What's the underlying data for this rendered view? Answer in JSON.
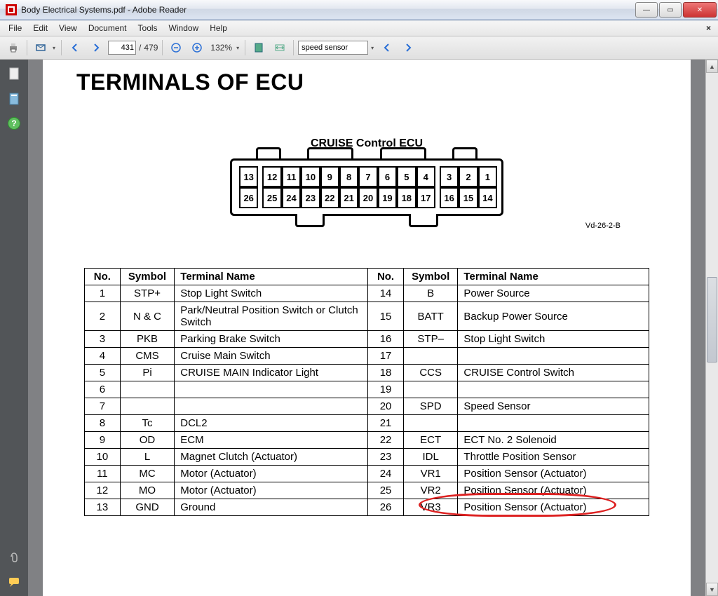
{
  "window": {
    "title": "Body Electrical Systems.pdf - Adobe Reader"
  },
  "menu": {
    "file": "File",
    "edit": "Edit",
    "view": "View",
    "document": "Document",
    "tools": "Tools",
    "window": "Window",
    "help": "Help"
  },
  "toolbar": {
    "page_current": "431",
    "page_sep": "/",
    "page_total": "479",
    "zoom": "132%",
    "search_value": "speed sensor"
  },
  "document": {
    "heading": "TERMINALS OF ECU",
    "ecu_title": "CRUISE Control ECU",
    "fig_ref": "Vd-26-2-B",
    "pins_top": [
      "13",
      "12",
      "11",
      "10",
      "9",
      "8",
      "7",
      "6",
      "5",
      "4",
      "3",
      "2",
      "1"
    ],
    "pins_bot": [
      "26",
      "25",
      "24",
      "23",
      "22",
      "21",
      "20",
      "19",
      "18",
      "17",
      "16",
      "15",
      "14"
    ],
    "table": {
      "headers": {
        "no": "No.",
        "symbol": "Symbol",
        "name": "Terminal Name"
      },
      "left": [
        {
          "no": "1",
          "sym": "STP+",
          "name": "Stop Light Switch"
        },
        {
          "no": "2",
          "sym": "N & C",
          "name": "Park/Neutral Position Switch or Clutch Switch"
        },
        {
          "no": "3",
          "sym": "PKB",
          "name": "Parking Brake Switch"
        },
        {
          "no": "4",
          "sym": "CMS",
          "name": "Cruise Main Switch"
        },
        {
          "no": "5",
          "sym": "Pi",
          "name": "CRUISE MAIN Indicator Light"
        },
        {
          "no": "6",
          "sym": "",
          "name": ""
        },
        {
          "no": "7",
          "sym": "",
          "name": ""
        },
        {
          "no": "8",
          "sym": "Tc",
          "name": "DCL2"
        },
        {
          "no": "9",
          "sym": "OD",
          "name": "ECM"
        },
        {
          "no": "10",
          "sym": "L",
          "name": "Magnet Clutch (Actuator)"
        },
        {
          "no": "11",
          "sym": "MC",
          "name": "Motor (Actuator)"
        },
        {
          "no": "12",
          "sym": "MO",
          "name": "Motor (Actuator)"
        },
        {
          "no": "13",
          "sym": "GND",
          "name": "Ground"
        }
      ],
      "right": [
        {
          "no": "14",
          "sym": "B",
          "name": "Power Source"
        },
        {
          "no": "15",
          "sym": "BATT",
          "name": "Backup Power Source"
        },
        {
          "no": "16",
          "sym": "STP–",
          "name": "Stop Light Switch"
        },
        {
          "no": "17",
          "sym": "",
          "name": ""
        },
        {
          "no": "18",
          "sym": "CCS",
          "name": "CRUISE Control Switch"
        },
        {
          "no": "19",
          "sym": "",
          "name": ""
        },
        {
          "no": "20",
          "sym": "SPD",
          "name": "Speed Sensor"
        },
        {
          "no": "21",
          "sym": "",
          "name": ""
        },
        {
          "no": "22",
          "sym": "ECT",
          "name": "ECT No. 2 Solenoid"
        },
        {
          "no": "23",
          "sym": "IDL",
          "name": "Throttle Position Sensor"
        },
        {
          "no": "24",
          "sym": "VR1",
          "name": "Position Sensor (Actuator)"
        },
        {
          "no": "25",
          "sym": "VR2",
          "name": "Position Sensor (Actuator)"
        },
        {
          "no": "26",
          "sym": "VR3",
          "name": "Position Sensor (Actuator)"
        }
      ]
    }
  }
}
